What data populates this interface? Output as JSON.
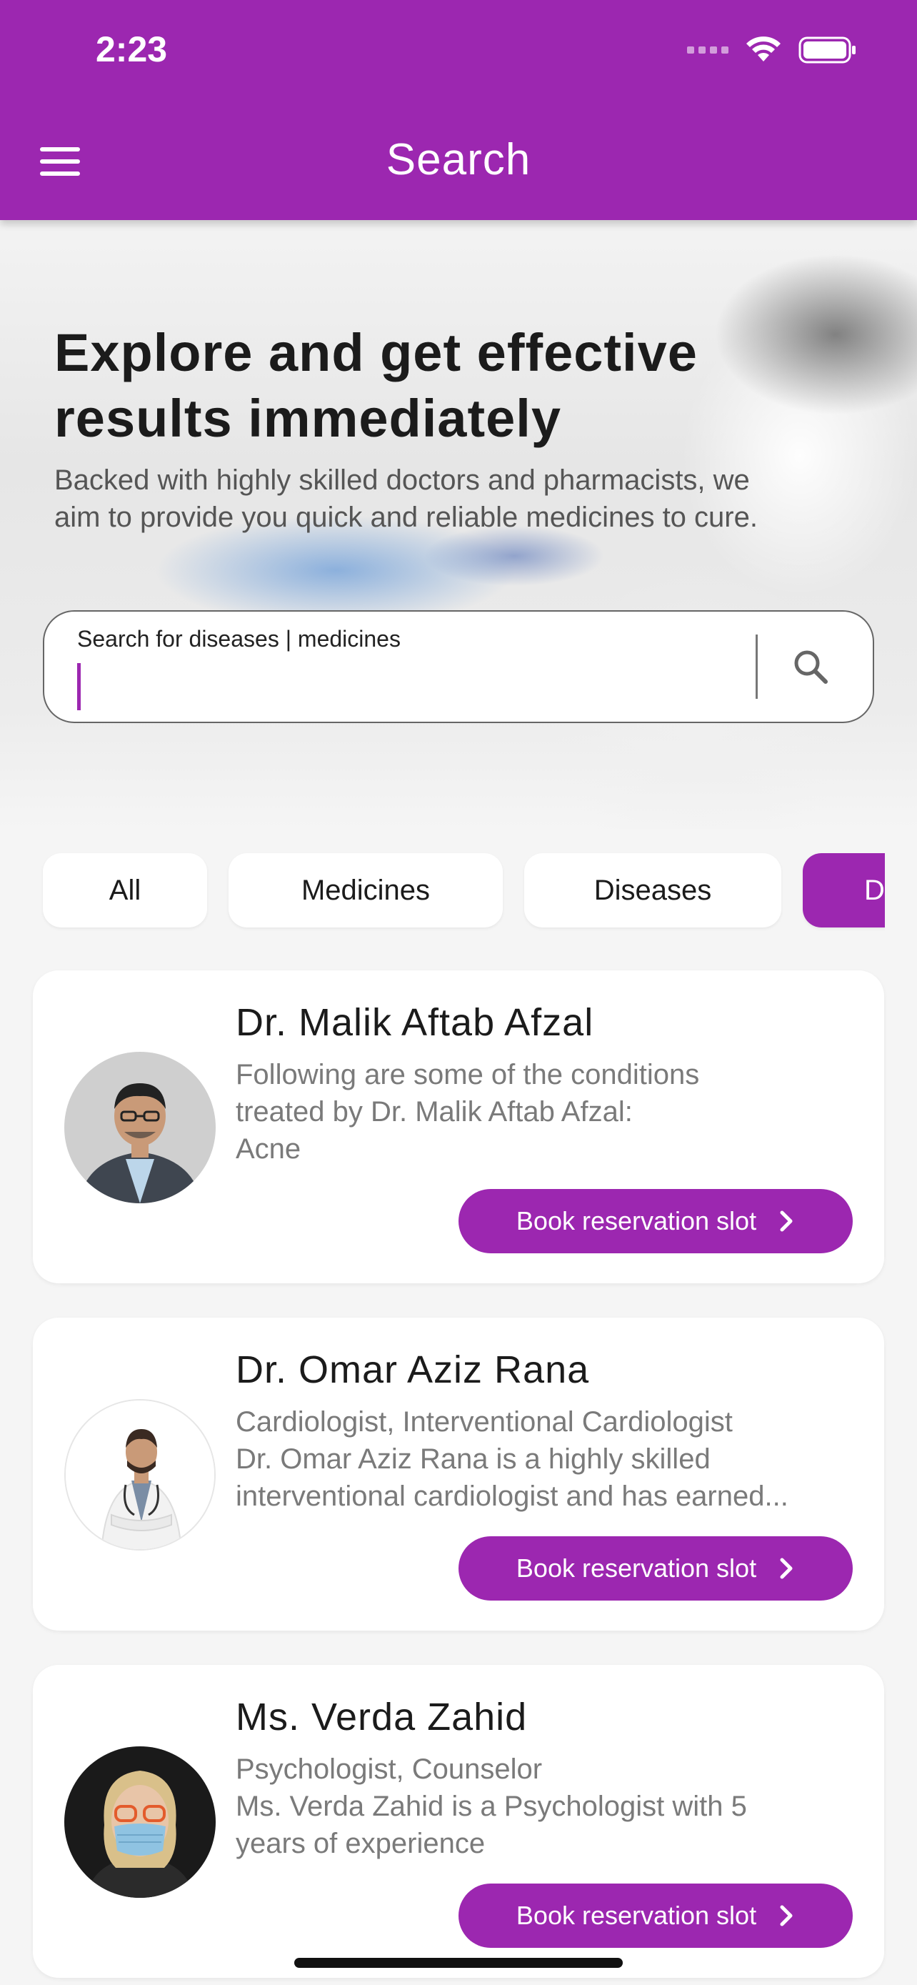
{
  "status_bar": {
    "time": "2:23"
  },
  "header": {
    "title": "Search",
    "menu_icon": "hamburger-menu-icon"
  },
  "hero": {
    "title_line1": "Explore and get effective",
    "title_line2": "results immediately",
    "subtitle_line1": "Backed with highly skilled doctors and pharmacists, we",
    "subtitle_line2": "aim to provide you quick and reliable medicines to cure."
  },
  "search": {
    "label": "Search for diseases | medicines",
    "value": "",
    "icon": "search-icon"
  },
  "filters": [
    {
      "label": "All",
      "active": false
    },
    {
      "label": "Medicines",
      "active": false
    },
    {
      "label": "Diseases",
      "active": false
    },
    {
      "label": "D",
      "active": true
    }
  ],
  "doctors": [
    {
      "name": "Dr. Malik Aftab Afzal",
      "desc_lines": [
        "Following are some of the conditions",
        "treated by Dr. Malik Aftab Afzal:",
        "Acne"
      ],
      "button_label": "Book reservation slot"
    },
    {
      "name": "Dr. Omar Aziz Rana",
      "desc_lines": [
        "Cardiologist, Interventional Cardiologist",
        "Dr. Omar Aziz Rana is a highly skilled",
        "interventional cardiologist and has earned..."
      ],
      "button_label": "Book reservation slot"
    },
    {
      "name": "Ms. Verda Zahid",
      "desc_lines": [
        "Psychologist, Counselor",
        "Ms. Verda Zahid is a Psychologist with 5",
        "years of experience"
      ],
      "button_label": "Book reservation slot"
    }
  ],
  "colors": {
    "primary": "#9c27b0",
    "background": "#f5f5f5",
    "card": "#ffffff"
  }
}
